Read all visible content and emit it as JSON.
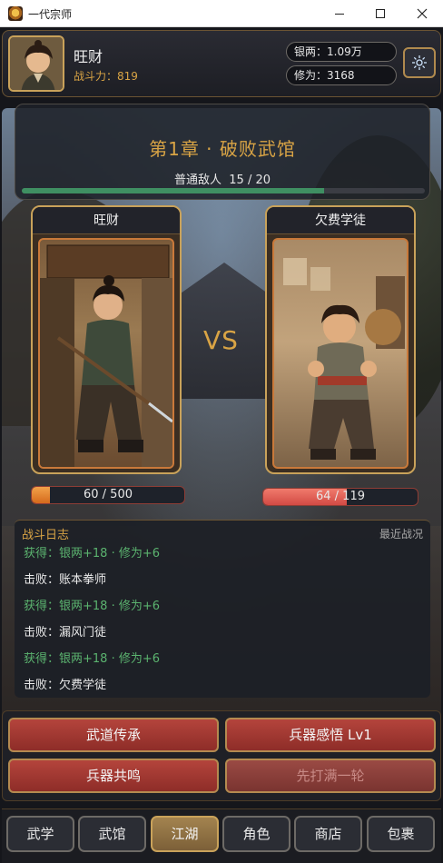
{
  "window": {
    "title": "一代宗师",
    "minimize": "—",
    "maximize": "□",
    "close": "✕"
  },
  "player": {
    "name": "旺财",
    "power_label": "战斗力：",
    "power_value": "819"
  },
  "stats": {
    "silver_label": "银两：",
    "silver_value": "1.09万",
    "cultivation_label": "修为：",
    "cultivation_value": "3168"
  },
  "settings_icon": "gear-icon",
  "chapter": {
    "title": "第1章 · 破败武馆",
    "progress_label": "普通敌人",
    "progress_text": "15 / 20",
    "progress_fraction": 0.75
  },
  "battle": {
    "player_card_name": "旺财",
    "enemy_card_name": "欠费学徒",
    "vs": "VS",
    "player_hp_text": "60 / 500",
    "player_hp_fraction": 0.12,
    "enemy_hp_text": "64 / 119",
    "enemy_hp_fraction": 0.54
  },
  "log": {
    "title": "战斗日志",
    "recent_label": "最近战况",
    "lines": [
      {
        "text": "获得：银两+18 · 修为+6",
        "kind": "reward"
      },
      {
        "text": "击败：账本拳师",
        "kind": "defeat"
      },
      {
        "text": "获得：银两+18 · 修为+6",
        "kind": "reward"
      },
      {
        "text": "击败：漏风门徒",
        "kind": "defeat"
      },
      {
        "text": "获得：银两+18 · 修为+6",
        "kind": "reward"
      },
      {
        "text": "击败：欠费学徒",
        "kind": "defeat"
      }
    ]
  },
  "actions": {
    "btn1": "武道传承",
    "btn2": "兵器感悟 Lv1",
    "btn3": "兵器共鸣",
    "btn4": "先打满一轮"
  },
  "tabs": [
    "武学",
    "武馆",
    "江湖",
    "角色",
    "商店",
    "包裹"
  ],
  "active_tab": "江湖",
  "colors": {
    "gold": "#d9a445",
    "reward_green": "#5bb36f",
    "button_red": "#a83a33",
    "tab_active": "#8f6f43"
  }
}
